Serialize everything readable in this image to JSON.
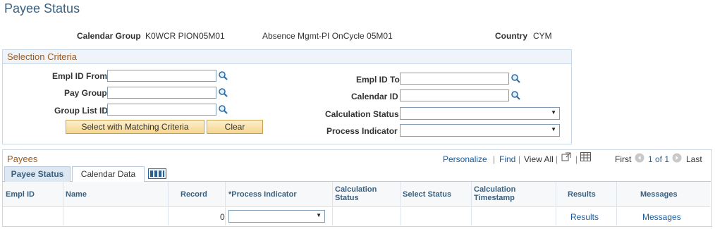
{
  "page": {
    "title": "Payee Status"
  },
  "header": {
    "calendar_group_label": "Calendar Group",
    "calendar_group_value": "K0WCR PION05M01",
    "calendar_group_desc": "Absence Mgmt-PI OnCycle 05M01",
    "country_label": "Country",
    "country_value": "CYM"
  },
  "selection": {
    "title": "Selection Criteria",
    "empl_from_label": "Empl ID From",
    "pay_group_label": "Pay Group",
    "group_list_label": "Group List ID",
    "empl_to_label": "Empl ID To",
    "calendar_id_label": "Calendar ID",
    "calc_status_label": "Calculation Status",
    "process_indicator_label": "Process Indicator",
    "select_button": "Select with Matching Criteria",
    "clear_button": "Clear"
  },
  "payees": {
    "title": "Payees",
    "personalize": "Personalize",
    "find": "Find",
    "sep1": "|",
    "view_all": "View All",
    "sep2": "|",
    "first": "First",
    "range": "1 of 1",
    "last": "Last",
    "tabs": [
      "Payee Status",
      "Calendar Data"
    ],
    "columns": {
      "empl_id": "Empl ID",
      "name": "Name",
      "record": "Record",
      "process_indicator": "*Process Indicator",
      "calc_status_1": "Calculation",
      "calc_status_2": "Status",
      "select_status": "Select Status",
      "calc_ts_1": "Calculation",
      "calc_ts_2": "Timestamp",
      "results": "Results",
      "messages": "Messages"
    },
    "rows": [
      {
        "record": "0",
        "results": "Results",
        "messages": "Messages"
      }
    ]
  }
}
